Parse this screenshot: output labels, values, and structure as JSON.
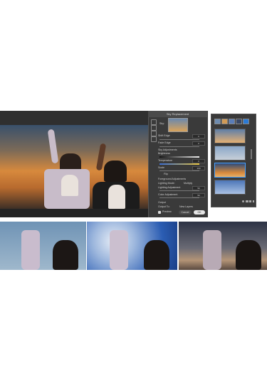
{
  "dialog": {
    "title": "Sky Replacement",
    "sky_label": "Sky:",
    "shift_edge_label": "Shift Edge",
    "shift_edge_value": "0",
    "fade_edge_label": "Fade Edge",
    "fade_edge_value": "0",
    "sky_adjustments_label": "Sky Adjustments",
    "brightness_label": "Brightness",
    "brightness_value": "0",
    "temperature_label": "Temperature",
    "temperature_value": "0",
    "scale_label": "Scale",
    "scale_value": "100",
    "flip_label": "Flip",
    "foreground_adjustments_label": "Foreground Adjustments",
    "lighting_mode_label": "Lighting Mode:",
    "lighting_mode_value": "Multiply",
    "lighting_adjustment_label": "Lighting Adjustment",
    "lighting_adjustment_value": "50",
    "color_adjustment_label": "Color Adjustment",
    "color_adjustment_value": "50",
    "output_label": "Output",
    "output_to_label": "Output To:",
    "output_to_value": "New Layers",
    "preview_label": "Preview",
    "cancel_label": "Cancel",
    "ok_label": "OK"
  },
  "colors": {
    "accent": "#4aa3ff",
    "dialog_bg": "#3a3a3a",
    "editor_bg": "#2b2b2b"
  },
  "icons": [
    "hand-icon",
    "brush-icon",
    "move-icon",
    "zoom-icon",
    "gear-icon",
    "folder-icon",
    "add-icon",
    "delete-icon"
  ]
}
